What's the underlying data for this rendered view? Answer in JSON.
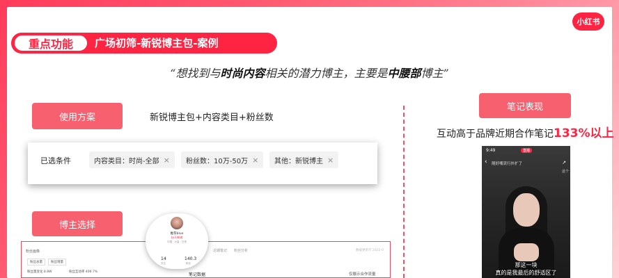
{
  "logo": "小红书",
  "banner": {
    "tag": "重点功能",
    "title": "广场初筛-新锐博主包-案例"
  },
  "quote": {
    "p1": "“想找到与",
    "b1": "时尚内容",
    "p2": "相关的潜力博主，主要是",
    "b2": "中腰部",
    "p3": "博主”"
  },
  "left": {
    "usage_btn": "使用方案",
    "usage_text": "新锐博主包+内容类目+粉丝数",
    "filter": {
      "label": "已选条件",
      "chips": [
        {
          "text": "内容类目：时尚-全部"
        },
        {
          "text": "粉丝数：10万-50万"
        },
        {
          "text": "其他：新锐博主"
        }
      ],
      "remove_glyph": "×"
    },
    "select_btn": "博主选择"
  },
  "right": {
    "perf_btn": "笔记表现",
    "perf_prefix": "互动高于品牌近期合作笔记",
    "perf_value": "133%",
    "perf_suffix": "以上"
  },
  "phone": {
    "time": "9:49",
    "live_badge": "直播",
    "back_glyph": "‹",
    "title": "随好嘴流行外扩了",
    "share_glyph": "↗",
    "side_text": "这个",
    "caption1": "那这一块",
    "caption2": "真的是我最后的舒适区了"
  },
  "screen": {
    "title": "粉丝画像",
    "tabs": [
      "粉丝总量",
      "粉丝增量"
    ],
    "tabs_right": [
      "近期笔记",
      "粉丝分析"
    ],
    "rows": [
      "粉丝量变化 8.8W",
      "粉丝互动率 406.7%"
    ],
    "note_section": "笔记数据",
    "checkbox_label": "仅展示合作流量",
    "time": "数据更新于 2022-0"
  },
  "popup": {
    "name": "推荐blue",
    "tag": "Lv3 新锐",
    "info": "中国 · 大量 · 日常",
    "stat1_value": "14",
    "stat1_label": "关注",
    "stat2_value": "140.3",
    "stat2_label": "粉丝"
  },
  "colors": {
    "brand": "#ff2442",
    "button": "#f7606f",
    "divider": "#f05060"
  }
}
